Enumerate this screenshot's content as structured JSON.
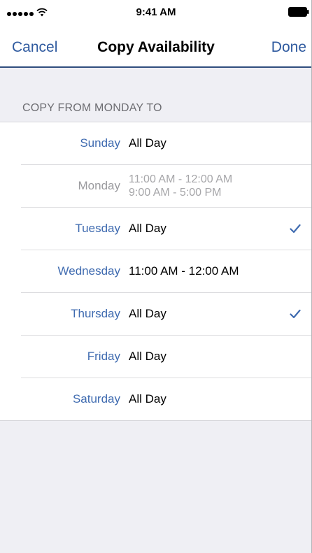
{
  "status_bar": {
    "time": "9:41 AM",
    "signal_icon": "signal-dots-icon",
    "wifi_icon": "wifi-icon",
    "battery_icon": "battery-icon"
  },
  "nav": {
    "cancel_label": "Cancel",
    "title": "Copy Availability",
    "done_label": "Done"
  },
  "section": {
    "header": "COPY FROM MONDAY TO"
  },
  "days": [
    {
      "name": "Sunday",
      "lines": [
        "All Day"
      ],
      "checked": false,
      "disabled": false
    },
    {
      "name": "Monday",
      "lines": [
        "11:00 AM - 12:00 AM",
        "9:00 AM - 5:00 PM"
      ],
      "checked": false,
      "disabled": true
    },
    {
      "name": "Tuesday",
      "lines": [
        "All Day"
      ],
      "checked": true,
      "disabled": false
    },
    {
      "name": "Wednesday",
      "lines": [
        "11:00 AM - 12:00 AM"
      ],
      "checked": false,
      "disabled": false
    },
    {
      "name": "Thursday",
      "lines": [
        "All Day"
      ],
      "checked": true,
      "disabled": false
    },
    {
      "name": "Friday",
      "lines": [
        "All Day"
      ],
      "checked": false,
      "disabled": false
    },
    {
      "name": "Saturday",
      "lines": [
        "All Day"
      ],
      "checked": false,
      "disabled": false
    }
  ],
  "colors": {
    "accent": "#2f5a9f",
    "day_label": "#3f6bb0",
    "nav_border": "#2f4d7e",
    "background": "#efeff4"
  }
}
